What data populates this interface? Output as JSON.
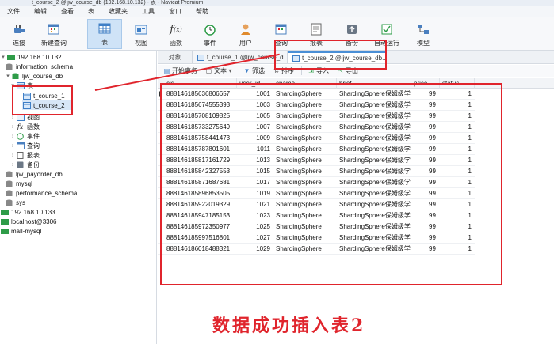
{
  "window": {
    "title": "t_course_2 @ljw_course_db (192.168.10.132) - 表 - Navicat Premium"
  },
  "menu": [
    "文件",
    "编辑",
    "查看",
    "表",
    "收藏夹",
    "工具",
    "窗口",
    "帮助"
  ],
  "toolbar": {
    "connect": "连接",
    "new_query": "新建查询",
    "table": "表",
    "view": "视图",
    "function": "函数",
    "event": "事件",
    "user": "用户",
    "query": "查询",
    "report": "报表",
    "backup": "备份",
    "automation": "自动运行",
    "model": "模型"
  },
  "tree": {
    "conn1": "192.168.10.132",
    "info_schema": "information_schema",
    "course_db": "ljw_course_db",
    "tables": "表",
    "t1": "t_course_1",
    "t2": "t_course_2",
    "views": "视图",
    "functions": "函数",
    "events": "事件",
    "queries": "查询",
    "reports": "报表",
    "backups": "备份",
    "payorder": "ljw_payorder_db",
    "mysql": "mysql",
    "perf": "performance_schema",
    "sys": "sys",
    "conn2": "192.168.10.133",
    "conn3": "localhost@3306",
    "conn4": "mall-mysql"
  },
  "tabs": {
    "objects": "对象",
    "tab1": "t_course_1 @ljw_course_d...",
    "tab2": "t_course_2 @ljw_course_db..."
  },
  "subtoolbar": {
    "begin_tx": "开始事务",
    "text": "文本",
    "filter": "筛选",
    "sort": "排序",
    "import": "导入",
    "export": "导出"
  },
  "columns": [
    "cid",
    "user_id",
    "cname",
    "brief",
    "price",
    "status"
  ],
  "rows": [
    [
      "888146185636806657",
      "1001",
      "ShardingSphere",
      "ShardingSphere保姆级学",
      "99",
      "1"
    ],
    [
      "888146185674555393",
      "1003",
      "ShardingSphere",
      "ShardingSphere保姆级学",
      "99",
      "1"
    ],
    [
      "888146185708109825",
      "1005",
      "ShardingSphere",
      "ShardingSphere保姆级学",
      "99",
      "1"
    ],
    [
      "888146185733275649",
      "1007",
      "ShardingSphere",
      "ShardingSphere保姆级学",
      "99",
      "1"
    ],
    [
      "888146185758441473",
      "1009",
      "ShardingSphere",
      "ShardingSphere保姆级学",
      "99",
      "1"
    ],
    [
      "888146185787801601",
      "1011",
      "ShardingSphere",
      "ShardingSphere保姆级学",
      "99",
      "1"
    ],
    [
      "888146185817161729",
      "1013",
      "ShardingSphere",
      "ShardingSphere保姆级学",
      "99",
      "1"
    ],
    [
      "888146185842327553",
      "1015",
      "ShardingSphere",
      "ShardingSphere保姆级学",
      "99",
      "1"
    ],
    [
      "888146185871687681",
      "1017",
      "ShardingSphere",
      "ShardingSphere保姆级学",
      "99",
      "1"
    ],
    [
      "888146185896853505",
      "1019",
      "ShardingSphere",
      "ShardingSphere保姆级学",
      "99",
      "1"
    ],
    [
      "888146185922019329",
      "1021",
      "ShardingSphere",
      "ShardingSphere保姆级学",
      "99",
      "1"
    ],
    [
      "888146185947185153",
      "1023",
      "ShardingSphere",
      "ShardingSphere保姆级学",
      "99",
      "1"
    ],
    [
      "888146185972350977",
      "1025",
      "ShardingSphere",
      "ShardingSphere保姆级学",
      "99",
      "1"
    ],
    [
      "888146185997516801",
      "1027",
      "ShardingSphere",
      "ShardingSphere保姆级学",
      "99",
      "1"
    ],
    [
      "888146186018488321",
      "1029",
      "ShardingSphere",
      "ShardingSphere保姆级学",
      "99",
      "1"
    ]
  ],
  "caption": "数据成功插入表2",
  "colors": {
    "annotation": "#e0242c",
    "selection": "#cfe3f7",
    "accent": "#4a8fd6"
  }
}
